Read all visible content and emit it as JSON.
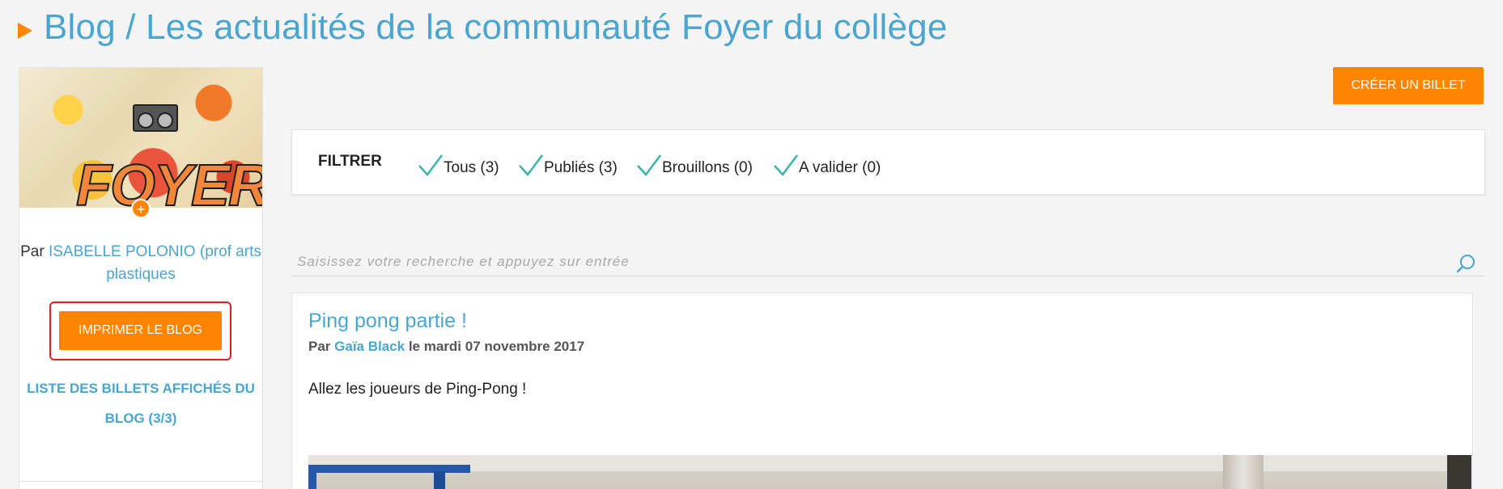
{
  "header": {
    "title": "Blog / Les actualités de la communauté Foyer du collège"
  },
  "sidebar": {
    "thumb_add_symbol": "+",
    "author_prefix": "Par ",
    "author_name": "ISABELLE POLONIO (prof arts plastiques",
    "print_button": "IMPRIMER LE BLOG",
    "posts_list_link": "LISTE DES BILLETS AFFICHÉS DU BLOG (3/3)"
  },
  "toolbar": {
    "create_button": "CRÉER UN BILLET"
  },
  "filters": {
    "label": "FILTRER",
    "items": [
      {
        "label": "Tous (3)",
        "checked": true
      },
      {
        "label": "Publiés (3)",
        "checked": true
      },
      {
        "label": "Brouillons (0)",
        "checked": true
      },
      {
        "label": "A valider (0)",
        "checked": true
      }
    ],
    "check_color": "#3bb3a4"
  },
  "search": {
    "placeholder": "Saisissez votre recherche et appuyez sur entrée",
    "value": ""
  },
  "post": {
    "title": "Ping pong partie !",
    "meta_prefix": "Par ",
    "author": "Gaïa Black",
    "date_text": " le mardi 07 novembre 2017",
    "body": "Allez les joueurs de Ping-Pong !"
  },
  "colors": {
    "accent": "#ff8500",
    "link": "#4aa6d0",
    "highlight_frame": "#e02020",
    "background": "#f4f4f4"
  }
}
